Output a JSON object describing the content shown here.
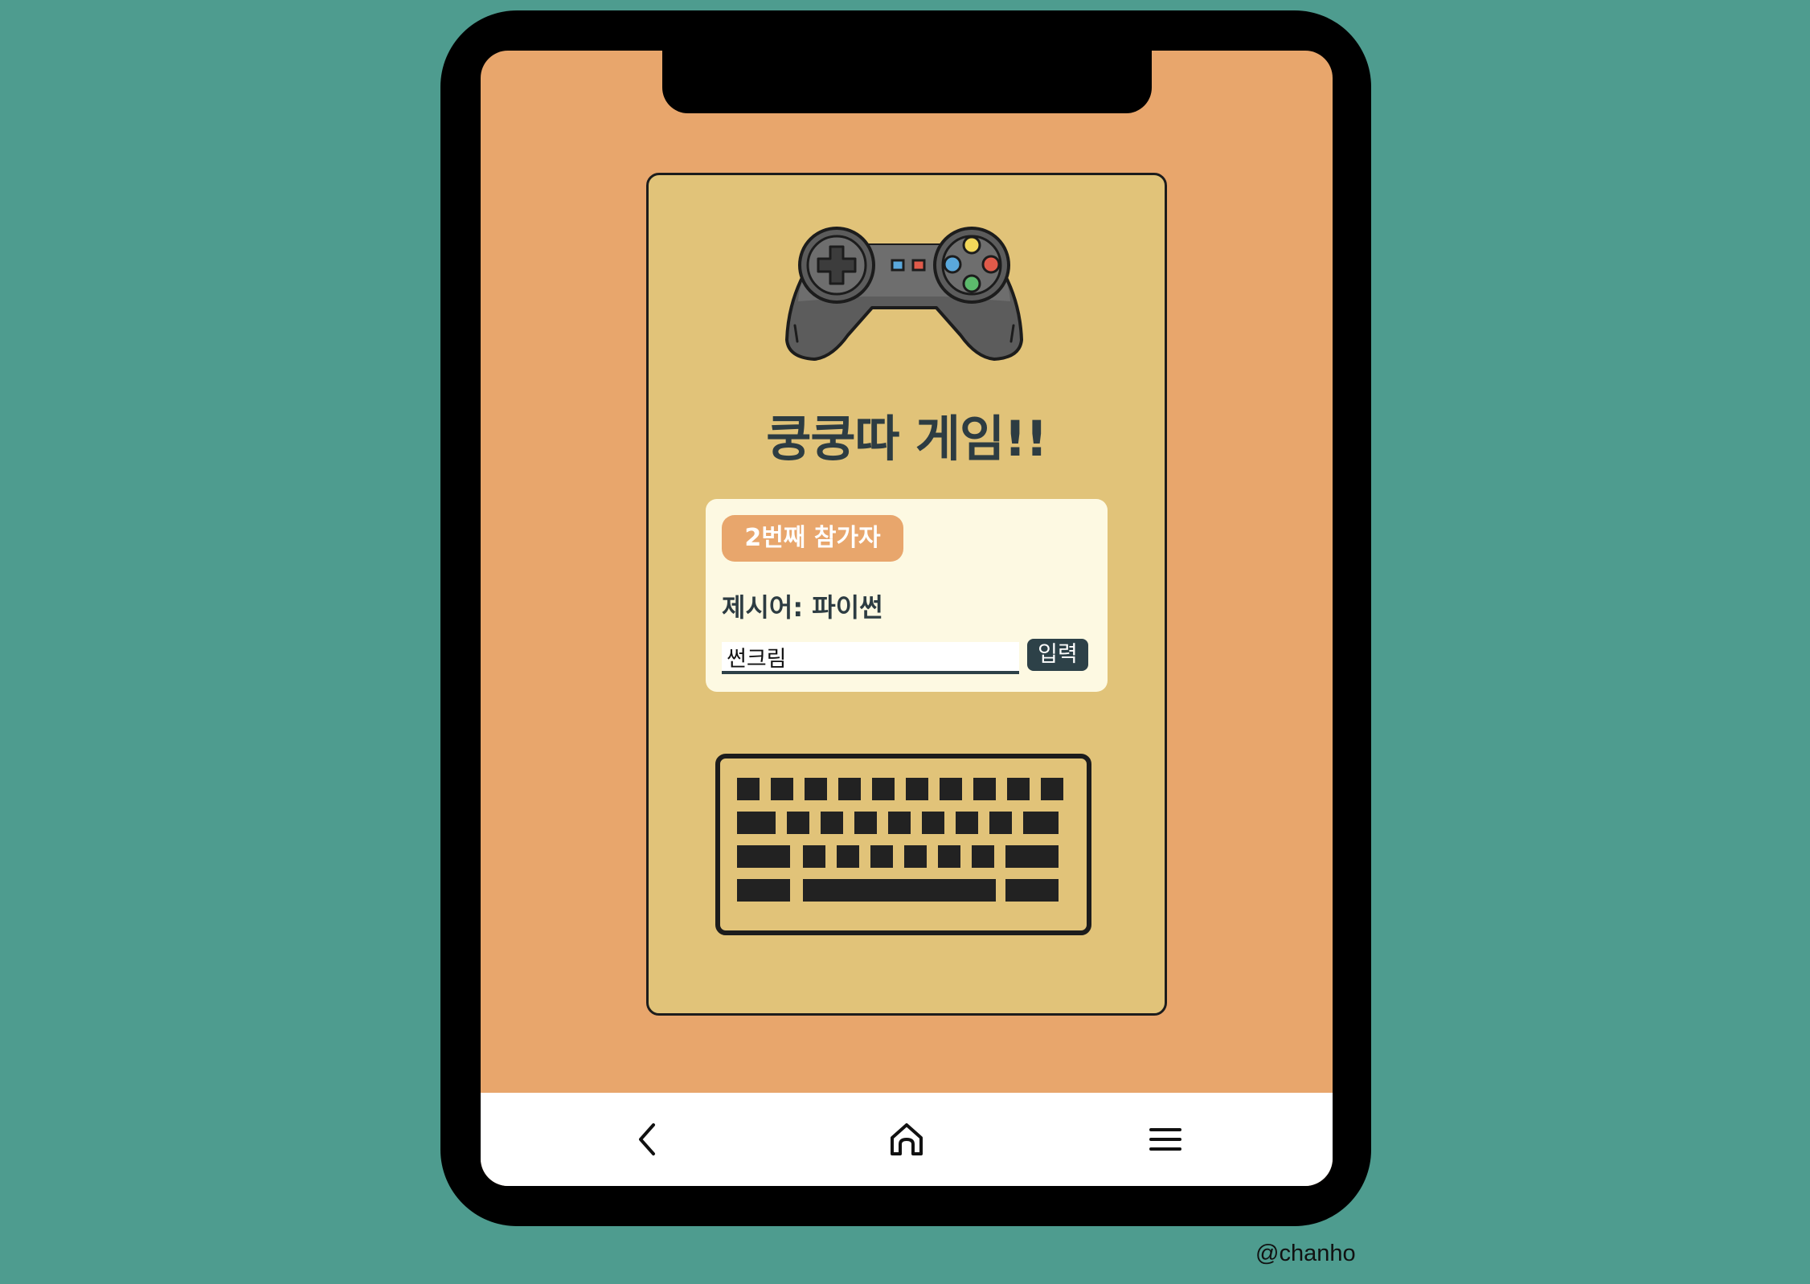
{
  "game": {
    "title": "쿵쿵따 게임!!",
    "participant_badge": "2번째 참가자",
    "prompt_text": "제시어: 파이썬",
    "answer_value": "썬크림",
    "submit_label": "입력"
  },
  "nav": {
    "back_icon": "chevron-left-icon",
    "home_icon": "home-icon",
    "menu_icon": "hamburger-menu-icon"
  },
  "watermark": "@chanho",
  "colors": {
    "background": "#4e9c8f",
    "screen": "#e8a66c",
    "card": "#e1c379",
    "panel": "#fdf9e2",
    "accent_dark": "#2d4148",
    "badge": "#e8a66c"
  }
}
